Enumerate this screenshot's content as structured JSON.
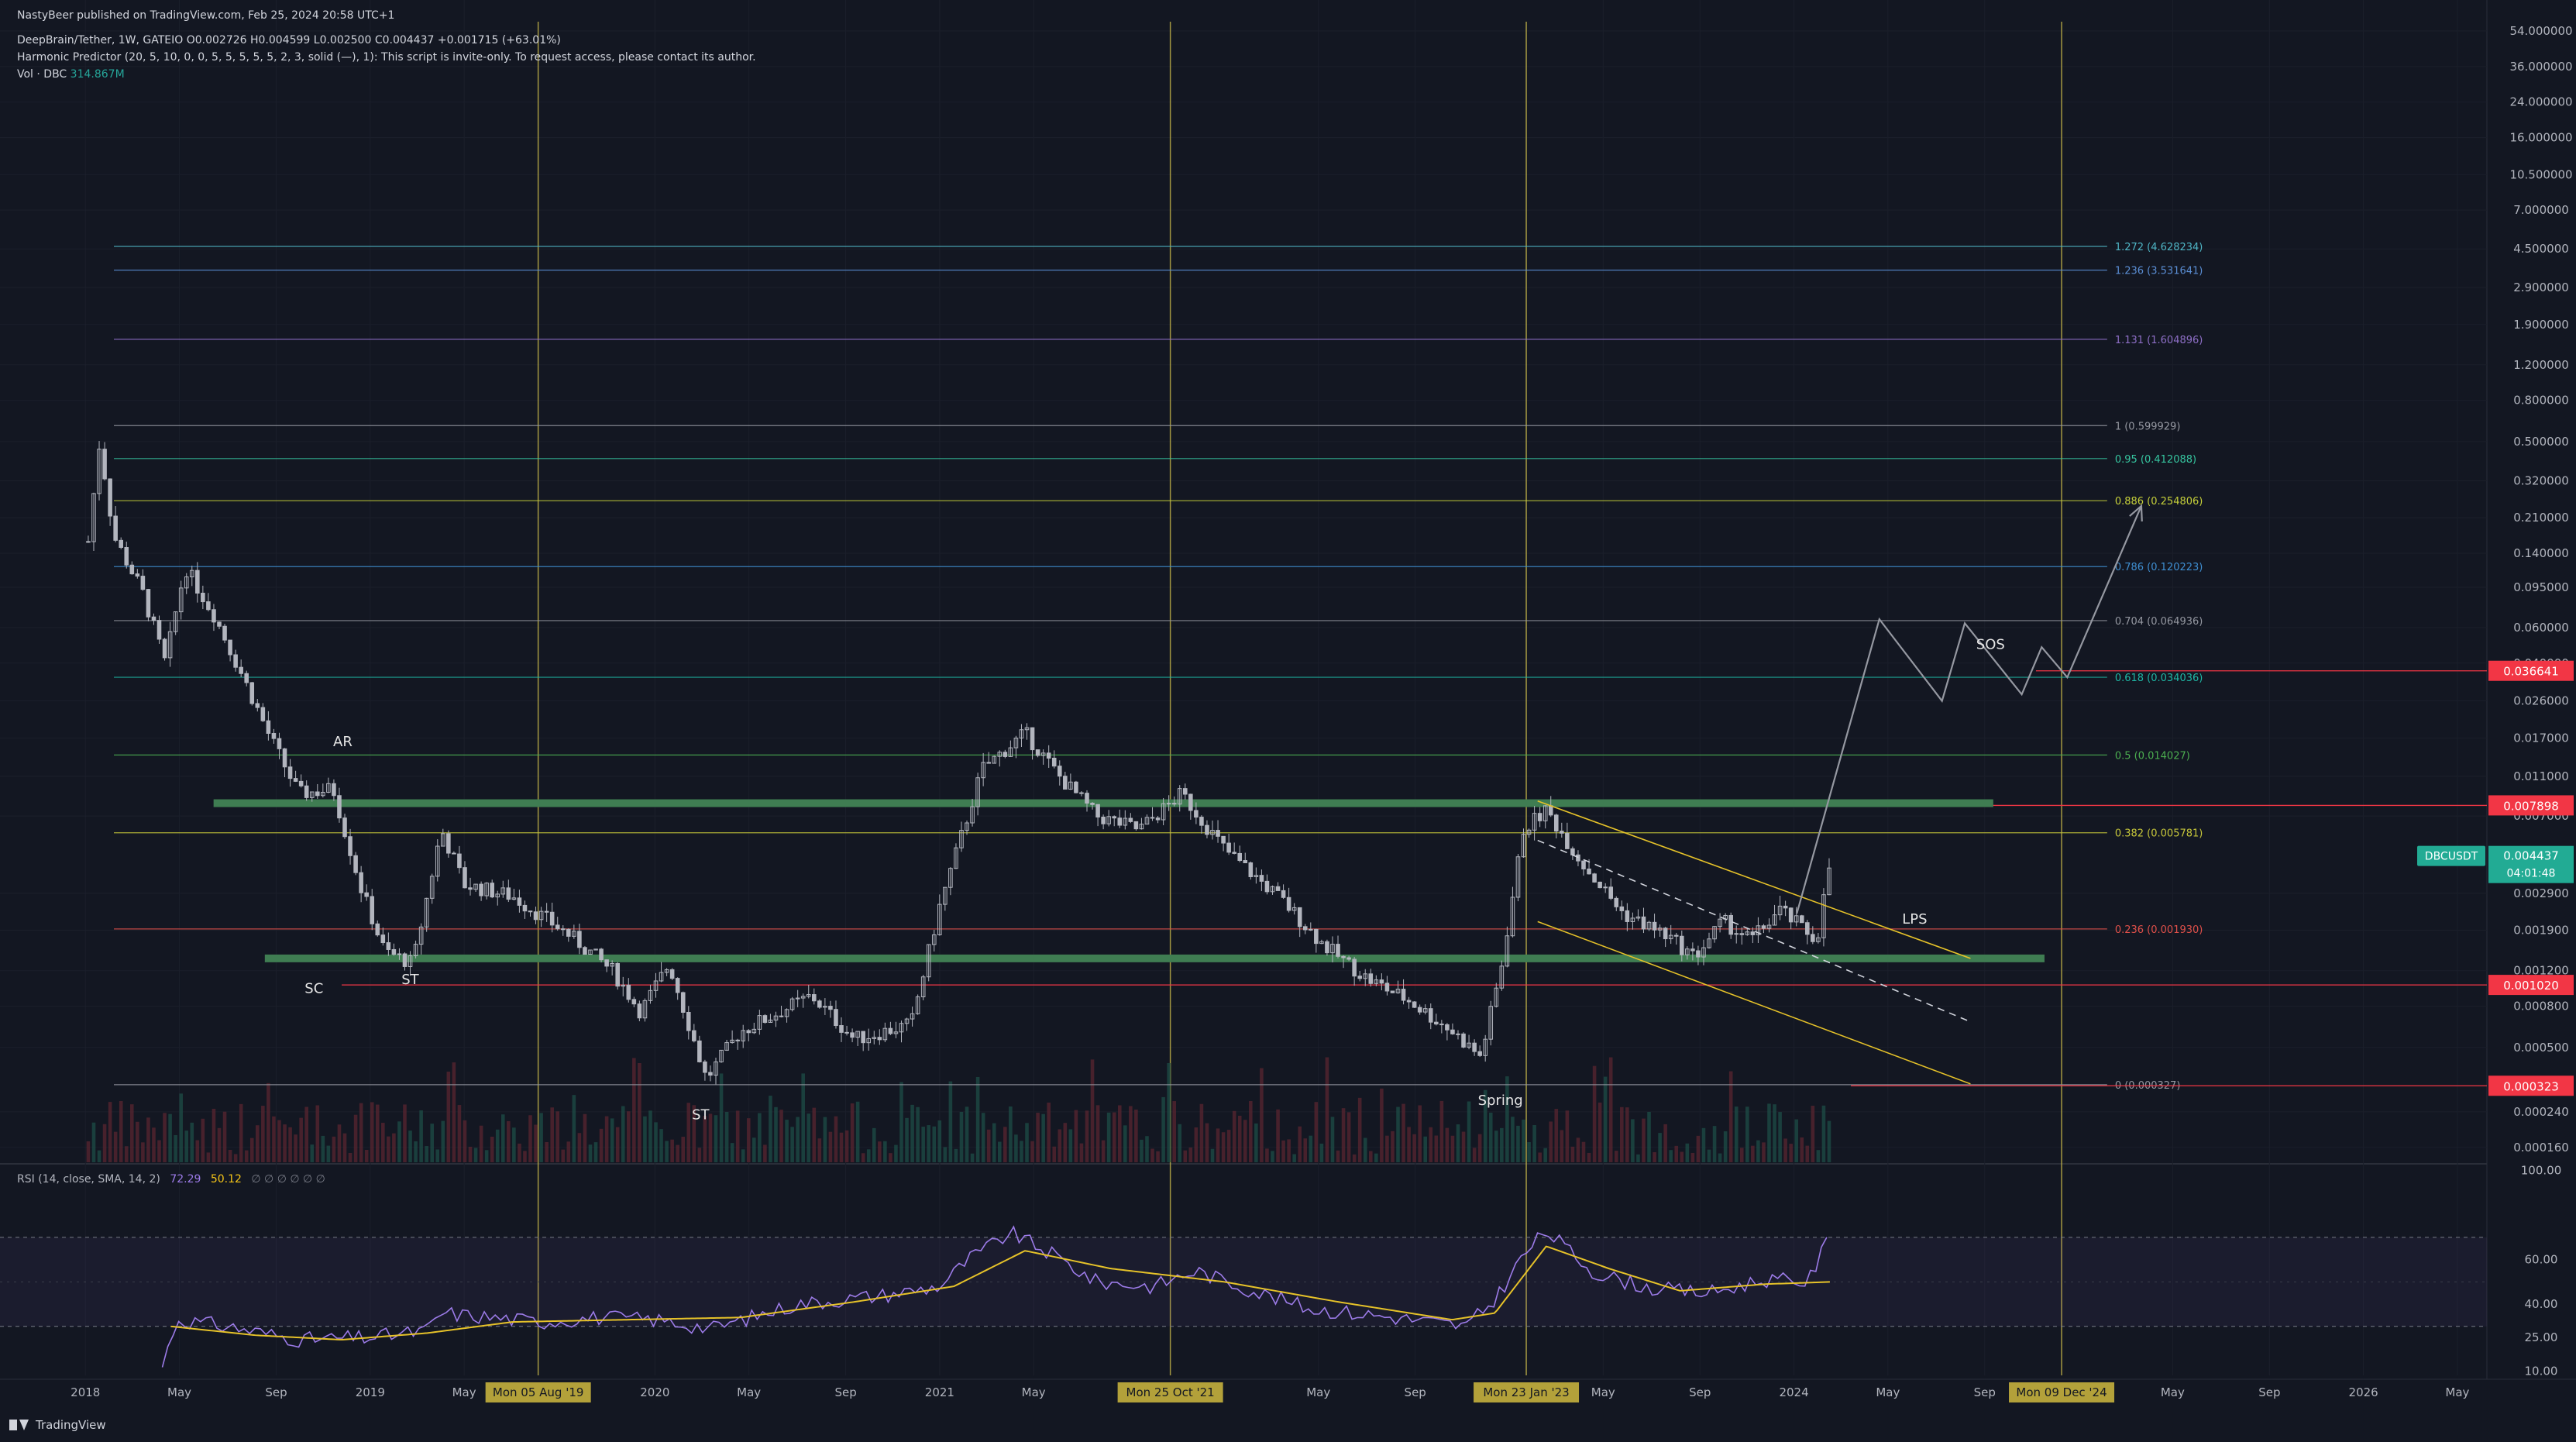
{
  "header": {
    "published": "NastyBeer published on TradingView.com, Feb 25, 2024 20:58 UTC+1",
    "symbol_line": "DeepBrain/Tether, 1W, GATEIO  O0.002726  H0.004599  L0.002500  C0.004437  +0.001715 (+63.01%)",
    "indicator_line": "Harmonic Predictor (20, 5, 10, 0, 0, 5, 5, 5, 5, 5, 2, 3, solid (—), 1): This script is invite-only. To request access, please contact its author.",
    "vol_label": "Vol · DBC",
    "vol_value": "314.867M"
  },
  "rsi_header": {
    "label": "RSI (14, close, SMA, 14, 2)",
    "value": "72.29",
    "sma": "50.12",
    "extra": "∅ ∅ ∅ ∅ ∅ ∅"
  },
  "brand": "TradingView",
  "colors": {
    "background": "#131722",
    "candle": "#b2b5be",
    "zone": "#3f7d52",
    "vline": "#c9b94a",
    "badge_red": "#f23645",
    "badge_teal": "#22ab94",
    "rsi": "#9c7be8",
    "rsi_sma": "#e6c229",
    "projection": "#9598a1",
    "channel": "#e6c229"
  },
  "chart_data": {
    "type": "candlestick",
    "symbol": "DBCUSDT",
    "timeframe": "1W",
    "y_scale": "log",
    "price_ticks": [
      "54.000000",
      "36.000000",
      "24.000000",
      "16.000000",
      "10.500000",
      "7.000000",
      "4.500000",
      "2.900000",
      "1.900000",
      "1.200000",
      "0.800000",
      "0.500000",
      "0.320000",
      "0.210000",
      "0.140000",
      "0.095000",
      "0.060000",
      "0.040000",
      "0.026000",
      "0.017000",
      "0.011000",
      "0.007000",
      "0.002900",
      "0.001900",
      "0.001200",
      "0.000800",
      "0.000500",
      "0.000240",
      "0.000160"
    ],
    "price_tick_values": [
      54,
      36,
      24,
      16,
      10.5,
      7,
      4.5,
      2.9,
      1.9,
      1.2,
      0.8,
      0.5,
      0.32,
      0.21,
      0.14,
      0.095,
      0.06,
      0.04,
      0.026,
      0.017,
      0.011,
      0.007,
      0.0029,
      0.0019,
      0.0012,
      0.0008,
      0.0005,
      0.00024,
      0.00016
    ],
    "time_ticks": [
      {
        "t": 2018.0,
        "label": "2018"
      },
      {
        "t": 2018.33,
        "label": "May"
      },
      {
        "t": 2018.67,
        "label": "Sep"
      },
      {
        "t": 2019.0,
        "label": "2019"
      },
      {
        "t": 2019.33,
        "label": "May"
      },
      {
        "t": 2020.0,
        "label": "2020"
      },
      {
        "t": 2020.33,
        "label": "May"
      },
      {
        "t": 2020.67,
        "label": "Sep"
      },
      {
        "t": 2021.0,
        "label": "2021"
      },
      {
        "t": 2021.33,
        "label": "May"
      },
      {
        "t": 2022.33,
        "label": "May"
      },
      {
        "t": 2022.67,
        "label": "Sep"
      },
      {
        "t": 2023.33,
        "label": "May"
      },
      {
        "t": 2023.67,
        "label": "Sep"
      },
      {
        "t": 2024.0,
        "label": "2024"
      },
      {
        "t": 2024.33,
        "label": "May"
      },
      {
        "t": 2024.67,
        "label": "Sep"
      },
      {
        "t": 2025.33,
        "label": "May"
      },
      {
        "t": 2025.67,
        "label": "Sep"
      },
      {
        "t": 2026.0,
        "label": "2026"
      },
      {
        "t": 2026.33,
        "label": "May"
      }
    ],
    "vertical_markers": [
      {
        "t": 2019.59,
        "label": "Mon 05 Aug '19"
      },
      {
        "t": 2021.81,
        "label": "Mon 25 Oct '21"
      },
      {
        "t": 2023.06,
        "label": "Mon 23 Jan '23"
      },
      {
        "t": 2024.94,
        "label": "Mon 09 Dec '24"
      }
    ],
    "fib_levels": [
      {
        "ratio": "1.272",
        "price": 4.628234,
        "label": "1.272 (4.628234)",
        "color": "#4fb6c6"
      },
      {
        "ratio": "1.236",
        "price": 3.531641,
        "label": "1.236 (3.531641)",
        "color": "#5b8fd6"
      },
      {
        "ratio": "1.131",
        "price": 1.604896,
        "label": "1.131 (1.604896)",
        "color": "#8e6fc7"
      },
      {
        "ratio": "1",
        "price": 0.599929,
        "label": "1 (0.599929)",
        "color": "#9598a1"
      },
      {
        "ratio": "0.95",
        "price": 0.412088,
        "label": "0.95 (0.412088)",
        "color": "#36c6a0"
      },
      {
        "ratio": "0.886",
        "price": 0.254806,
        "label": "0.886 (0.254806)",
        "color": "#c6d03a"
      },
      {
        "ratio": "0.786",
        "price": 0.120223,
        "label": "0.786 (0.120223)",
        "color": "#3f8fd2"
      },
      {
        "ratio": "0.704",
        "price": 0.064936,
        "label": "0.704 (0.064936)",
        "color": "#9598a1"
      },
      {
        "ratio": "0.618",
        "price": 0.034036,
        "label": "0.618 (0.034036)",
        "color": "#1fb7a5"
      },
      {
        "ratio": "0.5",
        "price": 0.014027,
        "label": "0.5 (0.014027)",
        "color": "#4caf50"
      },
      {
        "ratio": "0.382",
        "price": 0.005781,
        "label": "0.382 (0.005781)",
        "color": "#c6c63a"
      },
      {
        "ratio": "0.236",
        "price": 0.00193,
        "label": "0.236 (0.001930)",
        "color": "#e0504a"
      },
      {
        "ratio": "0",
        "price": 0.000327,
        "label": "0 (0.000327)",
        "color": "#9598a1"
      }
    ],
    "fib_start_t": 2018.1,
    "fib_end_t": 2025.1,
    "price_badges": [
      {
        "price": 0.036641,
        "label": "0.036641",
        "color": "#f23645"
      },
      {
        "price": 0.007898,
        "label": "0.007898",
        "color": "#f23645"
      },
      {
        "price": 0.004437,
        "label": "0.004437",
        "sublabel": "04:01:48",
        "color": "#22ab94",
        "symbol": "DBCUSDT"
      },
      {
        "price": 0.00102,
        "label": "0.001020",
        "color": "#f23645"
      },
      {
        "price": 0.000323,
        "label": "0.000323",
        "color": "#f23645"
      }
    ],
    "red_lines": [
      {
        "price": 0.007898,
        "t0": 2024.2
      },
      {
        "price": 0.036641,
        "t0": 2024.85
      },
      {
        "price": 0.00102,
        "t0": 2018.9
      },
      {
        "price": 0.000323,
        "t0": 2024.2
      }
    ],
    "zones": [
      {
        "price": 0.0081,
        "t0": 2018.45,
        "t1": 2024.7
      },
      {
        "price": 0.00138,
        "t0": 2018.63,
        "t1": 2024.88
      }
    ],
    "annotations": [
      {
        "text": "AR",
        "t": 2018.87,
        "price": 0.0155
      },
      {
        "text": "SC",
        "t": 2018.77,
        "price": 0.00093
      },
      {
        "text": "ST",
        "t": 2019.11,
        "price": 0.00103
      },
      {
        "text": "ST",
        "t": 2020.13,
        "price": 0.00022
      },
      {
        "text": "Spring",
        "t": 2022.89,
        "price": 0.00026
      },
      {
        "text": "LPS",
        "t": 2024.38,
        "price": 0.00205
      },
      {
        "text": "SOS",
        "t": 2024.64,
        "price": 0.047
      }
    ],
    "projection_path": [
      {
        "t": 2024.01,
        "p": 0.0023
      },
      {
        "t": 2024.3,
        "p": 0.066
      },
      {
        "t": 2024.52,
        "p": 0.026
      },
      {
        "t": 2024.6,
        "p": 0.063
      },
      {
        "t": 2024.8,
        "p": 0.028
      },
      {
        "t": 2024.87,
        "p": 0.048
      },
      {
        "t": 2024.96,
        "p": 0.034
      },
      {
        "t": 2025.22,
        "p": 0.24
      }
    ],
    "channel_lines": [
      {
        "t0": 2023.1,
        "p0": 0.0083,
        "t1": 2024.62,
        "p1": 0.00138,
        "style": "solid"
      },
      {
        "t0": 2023.1,
        "p0": 0.0021,
        "t1": 2024.62,
        "p1": 0.00033,
        "style": "solid"
      },
      {
        "t0": 2023.1,
        "p0": 0.0053,
        "t1": 2024.62,
        "p1": 0.00067,
        "style": "dashed"
      }
    ],
    "price_anchors": [
      {
        "t": 2018.01,
        "p": 0.16
      },
      {
        "t": 2018.05,
        "p": 0.5
      },
      {
        "t": 2018.1,
        "p": 0.17
      },
      {
        "t": 2018.2,
        "p": 0.09
      },
      {
        "t": 2018.28,
        "p": 0.04
      },
      {
        "t": 2018.35,
        "p": 0.12
      },
      {
        "t": 2018.45,
        "p": 0.07
      },
      {
        "t": 2018.55,
        "p": 0.035
      },
      {
        "t": 2018.65,
        "p": 0.017
      },
      {
        "t": 2018.75,
        "p": 0.009
      },
      {
        "t": 2018.87,
        "p": 0.0095
      },
      {
        "t": 2018.97,
        "p": 0.003
      },
      {
        "t": 2019.05,
        "p": 0.0015
      },
      {
        "t": 2019.15,
        "p": 0.0013
      },
      {
        "t": 2019.25,
        "p": 0.006
      },
      {
        "t": 2019.33,
        "p": 0.0032
      },
      {
        "t": 2019.5,
        "p": 0.0028
      },
      {
        "t": 2019.7,
        "p": 0.0018
      },
      {
        "t": 2019.85,
        "p": 0.0012
      },
      {
        "t": 2019.95,
        "p": 0.00075
      },
      {
        "t": 2020.05,
        "p": 0.0013
      },
      {
        "t": 2020.18,
        "p": 0.00035
      },
      {
        "t": 2020.3,
        "p": 0.0006
      },
      {
        "t": 2020.55,
        "p": 0.0009
      },
      {
        "t": 2020.7,
        "p": 0.00055
      },
      {
        "t": 2020.9,
        "p": 0.00065
      },
      {
        "t": 2021.0,
        "p": 0.0025
      },
      {
        "t": 2021.15,
        "p": 0.012
      },
      {
        "t": 2021.3,
        "p": 0.018
      },
      {
        "t": 2021.42,
        "p": 0.011
      },
      {
        "t": 2021.55,
        "p": 0.007
      },
      {
        "t": 2021.7,
        "p": 0.006
      },
      {
        "t": 2021.85,
        "p": 0.009
      },
      {
        "t": 2022.0,
        "p": 0.0048
      },
      {
        "t": 2022.2,
        "p": 0.0027
      },
      {
        "t": 2022.35,
        "p": 0.0016
      },
      {
        "t": 2022.5,
        "p": 0.0011
      },
      {
        "t": 2022.65,
        "p": 0.00085
      },
      {
        "t": 2022.8,
        "p": 0.0006
      },
      {
        "t": 2022.9,
        "p": 0.00045
      },
      {
        "t": 2022.97,
        "p": 0.0012
      },
      {
        "t": 2023.05,
        "p": 0.006
      },
      {
        "t": 2023.13,
        "p": 0.0075
      },
      {
        "t": 2023.25,
        "p": 0.0042
      },
      {
        "t": 2023.4,
        "p": 0.0023
      },
      {
        "t": 2023.55,
        "p": 0.0018
      },
      {
        "t": 2023.65,
        "p": 0.0014
      },
      {
        "t": 2023.75,
        "p": 0.0021
      },
      {
        "t": 2023.85,
        "p": 0.0017
      },
      {
        "t": 2023.95,
        "p": 0.0024
      },
      {
        "t": 2024.08,
        "p": 0.0017
      },
      {
        "t": 2024.13,
        "p": 0.0044
      }
    ],
    "rsi_anchors": [
      {
        "t": 2018.27,
        "v": 12
      },
      {
        "t": 2018.32,
        "v": 33
      },
      {
        "t": 2018.5,
        "v": 30
      },
      {
        "t": 2018.75,
        "v": 24
      },
      {
        "t": 2019.0,
        "v": 25
      },
      {
        "t": 2019.2,
        "v": 28
      },
      {
        "t": 2019.25,
        "v": 36
      },
      {
        "t": 2019.6,
        "v": 32
      },
      {
        "t": 2019.8,
        "v": 34
      },
      {
        "t": 2020.0,
        "v": 33
      },
      {
        "t": 2020.2,
        "v": 29
      },
      {
        "t": 2020.5,
        "v": 40
      },
      {
        "t": 2020.8,
        "v": 44
      },
      {
        "t": 2021.0,
        "v": 48
      },
      {
        "t": 2021.1,
        "v": 60
      },
      {
        "t": 2021.25,
        "v": 72
      },
      {
        "t": 2021.4,
        "v": 62
      },
      {
        "t": 2021.55,
        "v": 50
      },
      {
        "t": 2021.75,
        "v": 48
      },
      {
        "t": 2021.9,
        "v": 55
      },
      {
        "t": 2022.1,
        "v": 46
      },
      {
        "t": 2022.3,
        "v": 38
      },
      {
        "t": 2022.6,
        "v": 34
      },
      {
        "t": 2022.85,
        "v": 30
      },
      {
        "t": 2022.95,
        "v": 42
      },
      {
        "t": 2023.05,
        "v": 62
      },
      {
        "t": 2023.13,
        "v": 73
      },
      {
        "t": 2023.3,
        "v": 54
      },
      {
        "t": 2023.5,
        "v": 47
      },
      {
        "t": 2023.7,
        "v": 45
      },
      {
        "t": 2023.9,
        "v": 51
      },
      {
        "t": 2024.05,
        "v": 50
      },
      {
        "t": 2024.13,
        "v": 72
      }
    ],
    "rsi_sma_anchors": [
      {
        "t": 2018.3,
        "v": 30
      },
      {
        "t": 2018.6,
        "v": 26
      },
      {
        "t": 2018.9,
        "v": 24
      },
      {
        "t": 2019.2,
        "v": 27
      },
      {
        "t": 2019.5,
        "v": 32
      },
      {
        "t": 2019.9,
        "v": 33
      },
      {
        "t": 2020.3,
        "v": 34
      },
      {
        "t": 2020.7,
        "v": 41
      },
      {
        "t": 2021.05,
        "v": 48
      },
      {
        "t": 2021.3,
        "v": 64
      },
      {
        "t": 2021.6,
        "v": 56
      },
      {
        "t": 2022.0,
        "v": 50
      },
      {
        "t": 2022.4,
        "v": 41
      },
      {
        "t": 2022.8,
        "v": 33
      },
      {
        "t": 2022.95,
        "v": 36
      },
      {
        "t": 2023.13,
        "v": 66
      },
      {
        "t": 2023.35,
        "v": 56
      },
      {
        "t": 2023.6,
        "v": 46
      },
      {
        "t": 2023.9,
        "v": 49
      },
      {
        "t": 2024.13,
        "v": 50
      }
    ],
    "rsi_ticks": [
      100,
      60,
      40,
      25,
      10
    ],
    "rsi_tick_labels": [
      "100.00",
      "60.00",
      "40.00",
      "25.00",
      "10.00"
    ],
    "rsi_band": [
      30,
      70
    ]
  }
}
